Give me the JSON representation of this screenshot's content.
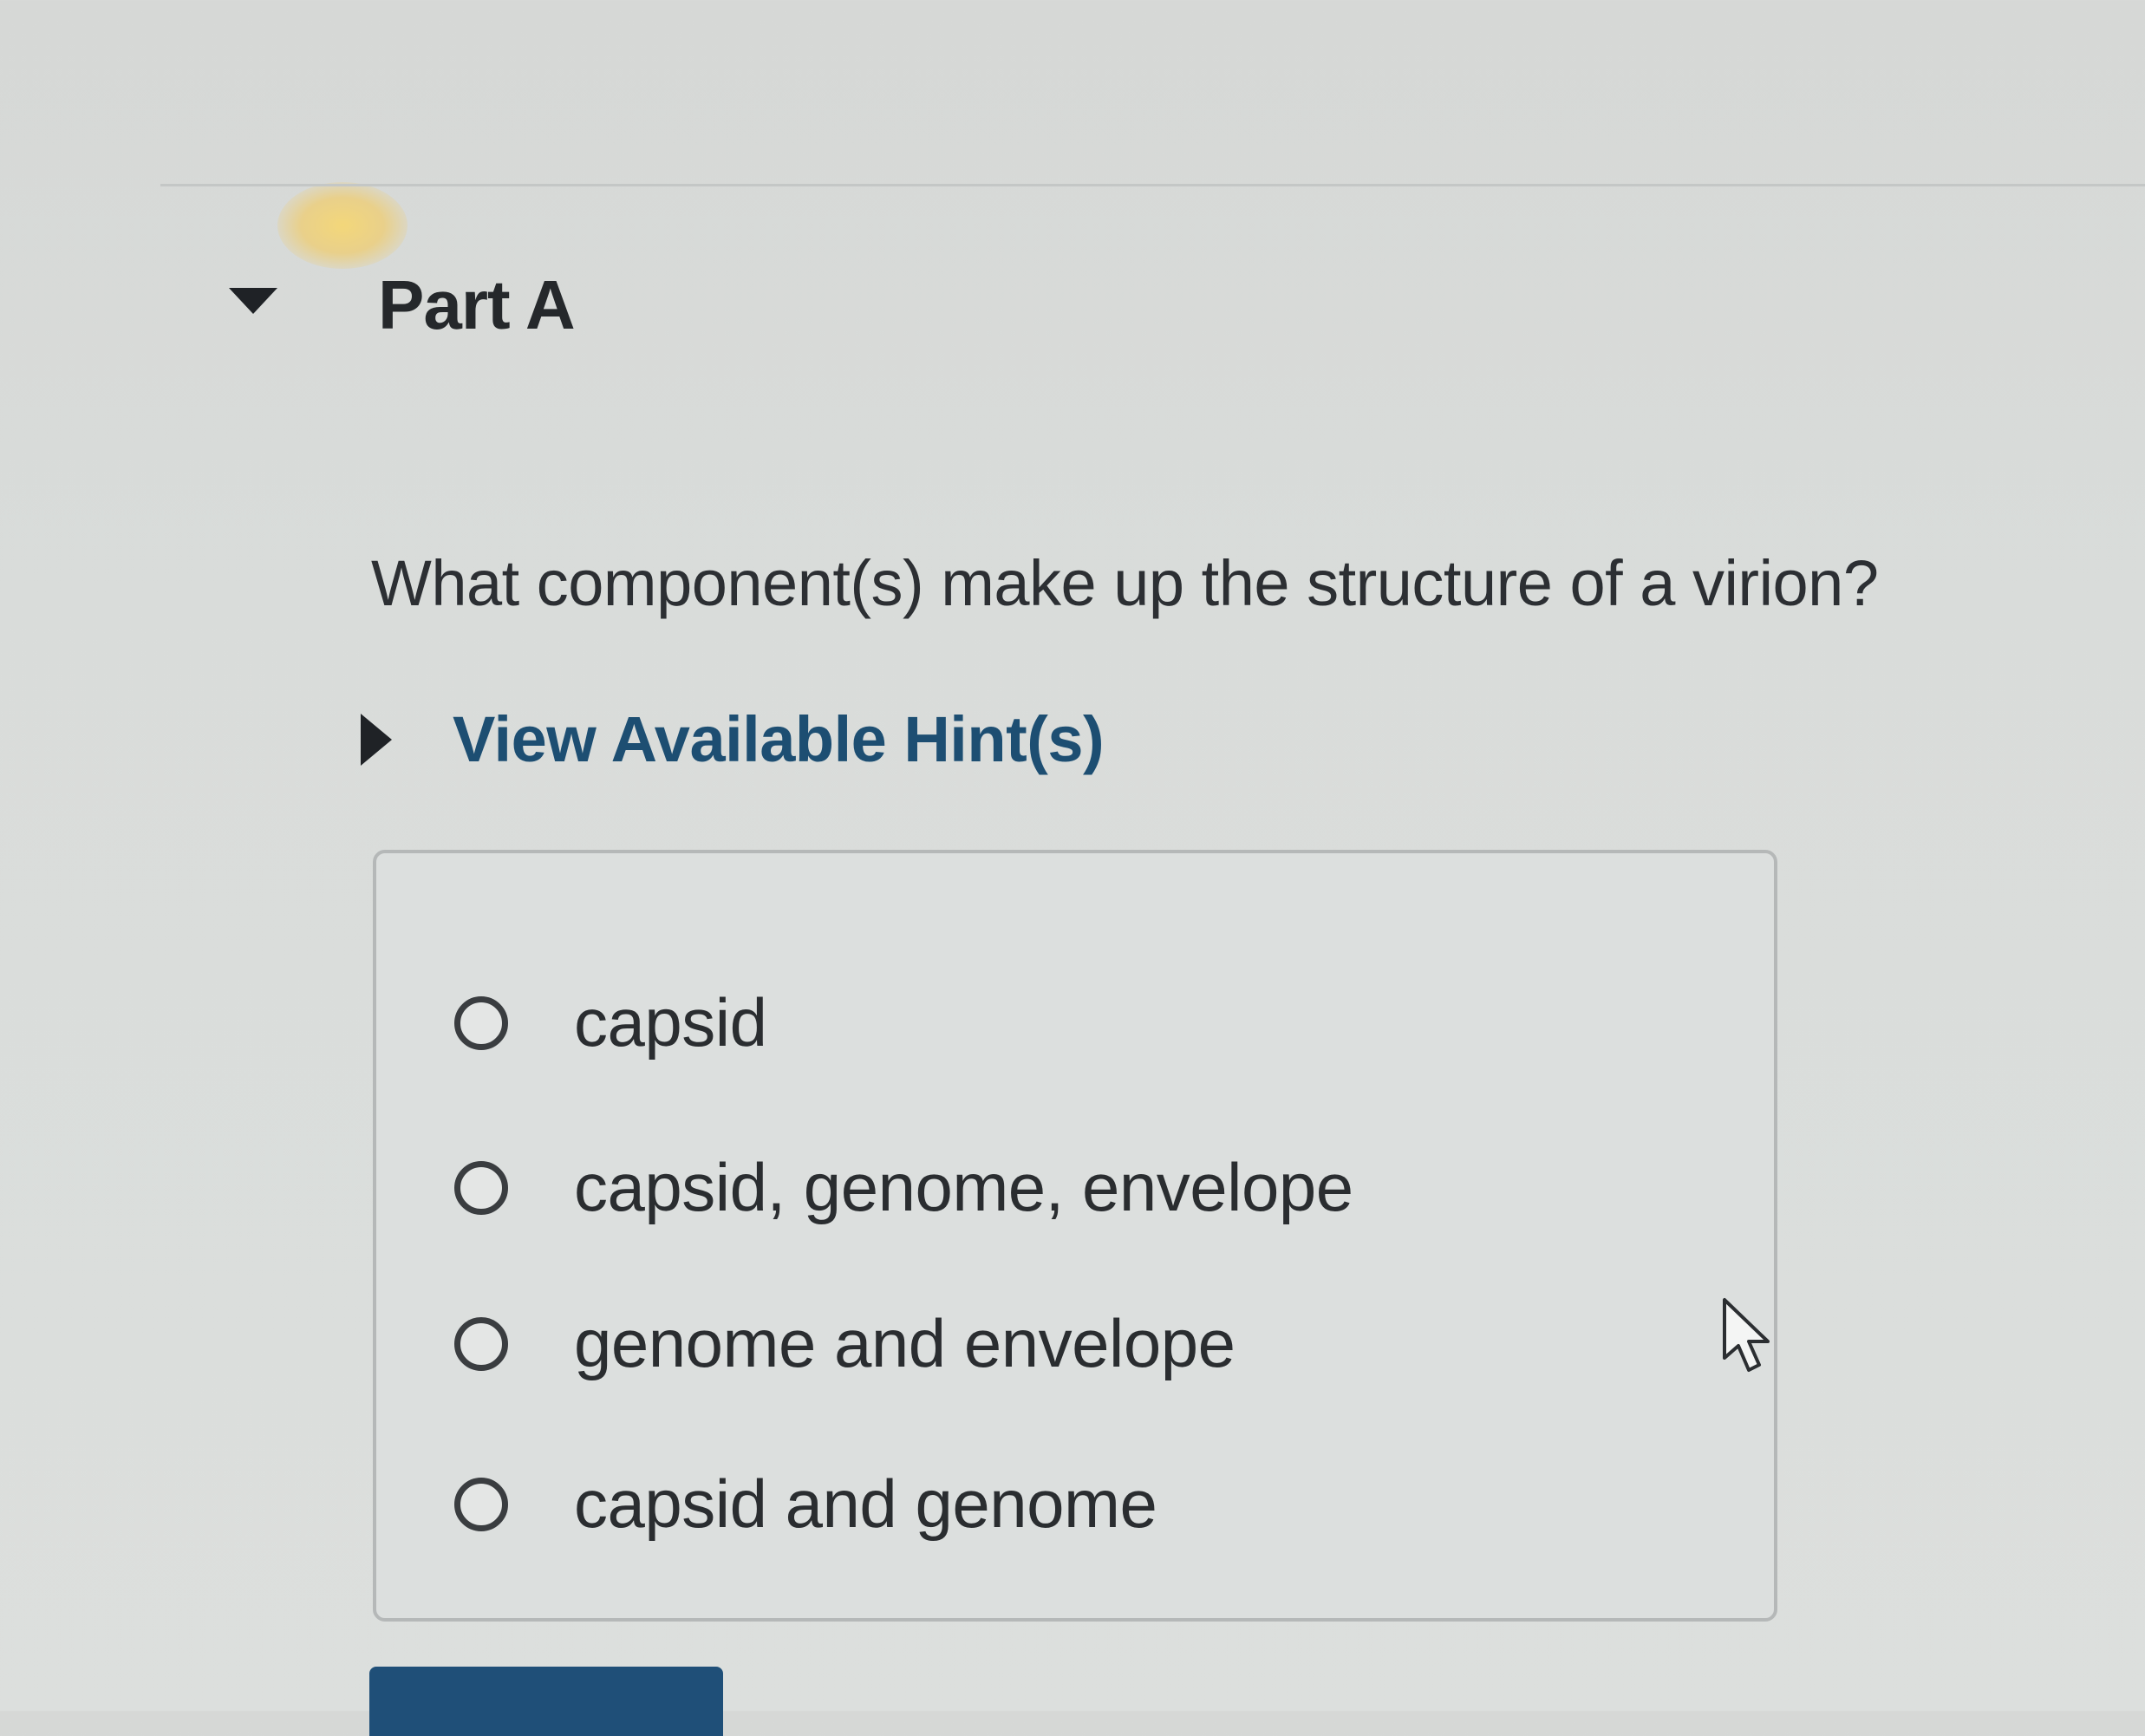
{
  "part": {
    "title": "Part A",
    "expanded": true
  },
  "question": {
    "text": "What component(s) make up the structure of a virion?"
  },
  "hints": {
    "label": "View Available Hint(s)"
  },
  "options": [
    {
      "label": "capsid",
      "selected": false
    },
    {
      "label": "capsid, genome, envelope",
      "selected": false
    },
    {
      "label": "genome and envelope",
      "selected": false
    },
    {
      "label": "capsid and genome",
      "selected": false
    }
  ],
  "colors": {
    "hint_link": "#1d4e72",
    "submit_button": "#1f4f78",
    "background": "#d9dcda"
  },
  "icons": {
    "part_toggle": "caret-down-icon",
    "hint_toggle": "caret-right-icon",
    "cursor": "mouse-pointer-icon"
  }
}
